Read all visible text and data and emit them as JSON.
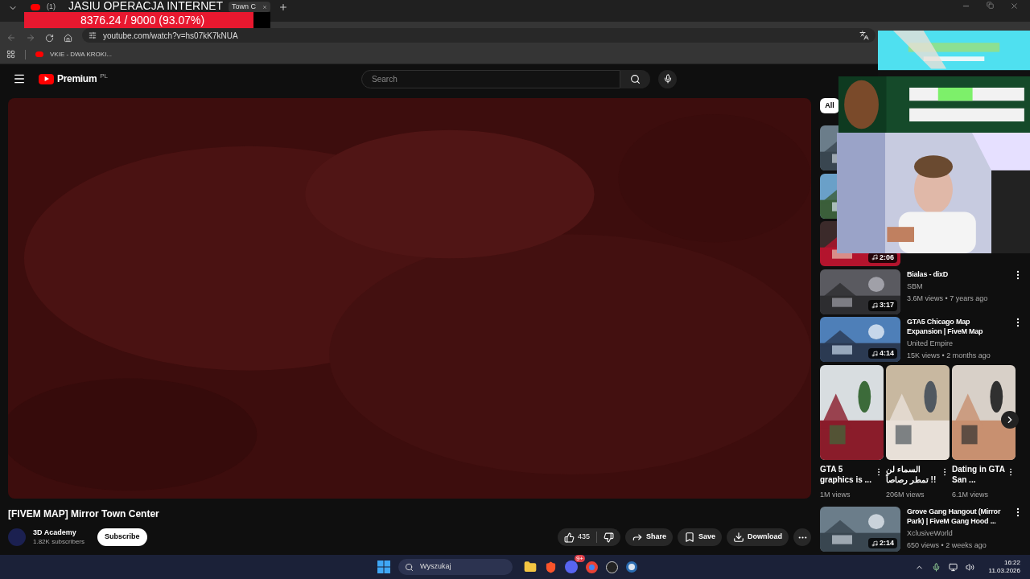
{
  "overlay": {
    "title": "JASIU OPERACJA INTERNET",
    "progress": {
      "level": 0.9307,
      "reading": "8376.24 / 9000 (93.07%)"
    }
  },
  "browser": {
    "tabs": [
      {
        "title": "(1)",
        "selected": false
      },
      {
        "title": "Town C",
        "selected": true
      }
    ],
    "url": "youtube.com/watch?v=hs07kK7kNUA",
    "bookmarks": [
      "VKIE - DWA KROKI..."
    ]
  },
  "youtube": {
    "logo": "Premium",
    "region": "PL",
    "search": {
      "placeholder": "Search"
    },
    "video": {
      "title": "[FIVEM MAP] Mirror Town Center",
      "channel": "3D Academy",
      "subscribers": "1.82K subscribers",
      "subscribe": "Subscribe",
      "likes": "435",
      "actions": [
        {
          "kind": "share",
          "label": "Share"
        },
        {
          "kind": "save",
          "label": "Save"
        },
        {
          "kind": "download",
          "label": "Download"
        }
      ]
    },
    "sidebar": {
      "chips": [
        {
          "label": "All",
          "selected": true
        }
      ],
      "videos": [
        {
          "kind": "video"
        },
        {
          "kind": "video"
        },
        {
          "kind": "video",
          "duration": "2:06"
        },
        {
          "kind": "video",
          "title": "Bialas - dixD",
          "channel": "SBM",
          "meta": "3.6M views • 7 years ago",
          "duration": "3:17"
        },
        {
          "kind": "video",
          "title": "GTA5 Chicago Map Expansion | FiveM Map",
          "channel": "United Empire",
          "meta": "15K views • 2 months ago",
          "duration": "4:14"
        },
        {
          "kind": "shorts"
        },
        {
          "kind": "video",
          "title": "Grove Gang Hangout (Mirror Park) | FiveM Gang Hood ...",
          "channel": "XclusiveWorld",
          "meta": "650 views • 2 weeks ago",
          "duration": "2:14"
        }
      ],
      "shorts": [
        {
          "title": "GTA 5 graphics is ...",
          "views": "1M views"
        },
        {
          "title": "السماء لن تمطر رصاصاً !!",
          "views": "206M views"
        },
        {
          "title": "Dating in GTA San ...",
          "views": "6.1M views"
        }
      ]
    }
  },
  "taskbar": {
    "search": {
      "placeholder": "Wyszukaj"
    },
    "badge": "9+",
    "time": "16:22",
    "date": "11.03.2026"
  }
}
